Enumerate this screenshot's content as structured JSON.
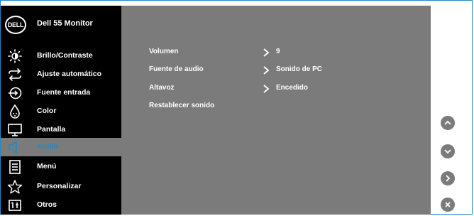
{
  "monitor": {
    "logo_text": "DELL",
    "title": "Dell 55 Monitor"
  },
  "menu": [
    {
      "label": "Brillo/Contraste",
      "icon": "brightness-icon",
      "active": false
    },
    {
      "label": "Ajuste automático",
      "icon": "auto-adjust-icon",
      "active": false
    },
    {
      "label": "Fuente entrada",
      "icon": "input-source-icon",
      "active": false
    },
    {
      "label": "Color",
      "icon": "color-icon",
      "active": false
    },
    {
      "label": "Pantalla",
      "icon": "display-icon",
      "active": false
    },
    {
      "label": "Audio",
      "icon": "speaker-icon",
      "active": true
    },
    {
      "label": "Menú",
      "icon": "menu-icon",
      "active": false
    },
    {
      "label": "Personalizar",
      "icon": "star-icon",
      "active": false
    },
    {
      "label": "Otros",
      "icon": "others-icon",
      "active": false
    }
  ],
  "audio_settings": [
    {
      "label": "Volumen",
      "value": "9"
    },
    {
      "label": "Fuente de audio",
      "value": "Sonido de PC"
    },
    {
      "label": "Altavoz",
      "value": "Encedido"
    },
    {
      "label": "Restablecer sonido",
      "value": ""
    }
  ],
  "nav_buttons": [
    "up-button",
    "down-button",
    "right-button",
    "close-button"
  ],
  "colors": {
    "accent": "#1f89c9",
    "sidebar": "#000000",
    "panel": "#7b7b7b",
    "text": "#ffffff"
  }
}
